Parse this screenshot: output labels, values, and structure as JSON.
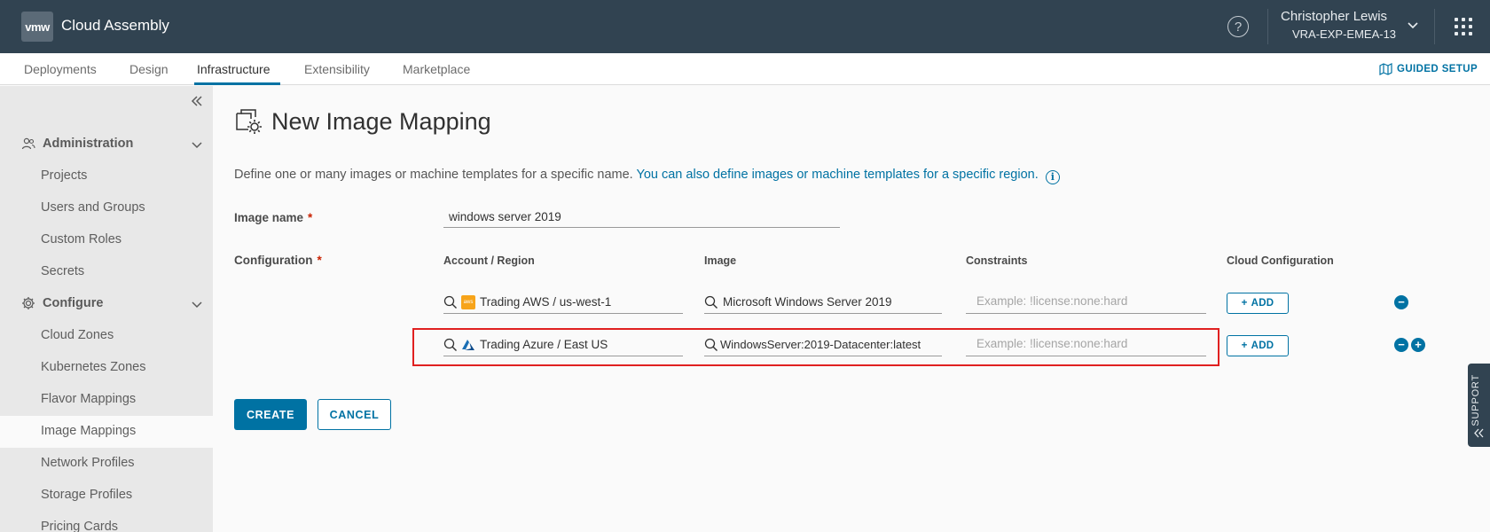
{
  "header": {
    "logo_text": "vmw",
    "app_title": "Cloud Assembly",
    "help_symbol": "?",
    "user_name": "Christopher Lewis",
    "user_org": "VRA-EXP-EMEA-13"
  },
  "nav": {
    "tabs": [
      {
        "label": "Deployments"
      },
      {
        "label": "Design"
      },
      {
        "label": "Infrastructure"
      },
      {
        "label": "Extensibility"
      },
      {
        "label": "Marketplace"
      }
    ],
    "active_tab": "Infrastructure",
    "guided_setup": "GUIDED SETUP"
  },
  "sidebar": {
    "sections": [
      {
        "label": "Administration",
        "items": [
          {
            "label": "Projects"
          },
          {
            "label": "Users and Groups"
          },
          {
            "label": "Custom Roles"
          },
          {
            "label": "Secrets"
          }
        ]
      },
      {
        "label": "Configure",
        "items": [
          {
            "label": "Cloud Zones"
          },
          {
            "label": "Kubernetes Zones"
          },
          {
            "label": "Flavor Mappings"
          },
          {
            "label": "Image Mappings"
          },
          {
            "label": "Network Profiles"
          },
          {
            "label": "Storage Profiles"
          },
          {
            "label": "Pricing Cards"
          }
        ]
      }
    ],
    "active_item": "Image Mappings"
  },
  "page": {
    "title": "New Image Mapping",
    "description": "Define one or many images or machine templates for a specific name.",
    "description_link": "You can also define images or machine templates for a specific region.",
    "image_name_label": "Image name",
    "image_name_value": "windows server 2019",
    "configuration_label": "Configuration",
    "required_mark": "*",
    "columns": {
      "account_region": "Account / Region",
      "image": "Image",
      "constraints": "Constraints",
      "cloud_configuration": "Cloud Configuration"
    },
    "rows": [
      {
        "account_region": "Trading AWS / us-west-1",
        "account_icon": "aws-icon",
        "image": "Microsoft Windows Server 2019",
        "constraints_placeholder": "Example: !license:none:hard",
        "add_label": "ADD"
      },
      {
        "account_region": "Trading Azure / East US",
        "account_icon": "azure-icon",
        "image": "WindowsServer:2019-Datacenter:latest",
        "constraints_placeholder": "Example: !license:none:hard",
        "add_label": "ADD"
      }
    ],
    "create_label": "CREATE",
    "cancel_label": "CANCEL"
  },
  "support_tab": "SUPPORT",
  "colors": {
    "header_bg": "#314351",
    "accent": "#0072a3",
    "highlight": "#e02020",
    "aws": "#f7a41a"
  }
}
